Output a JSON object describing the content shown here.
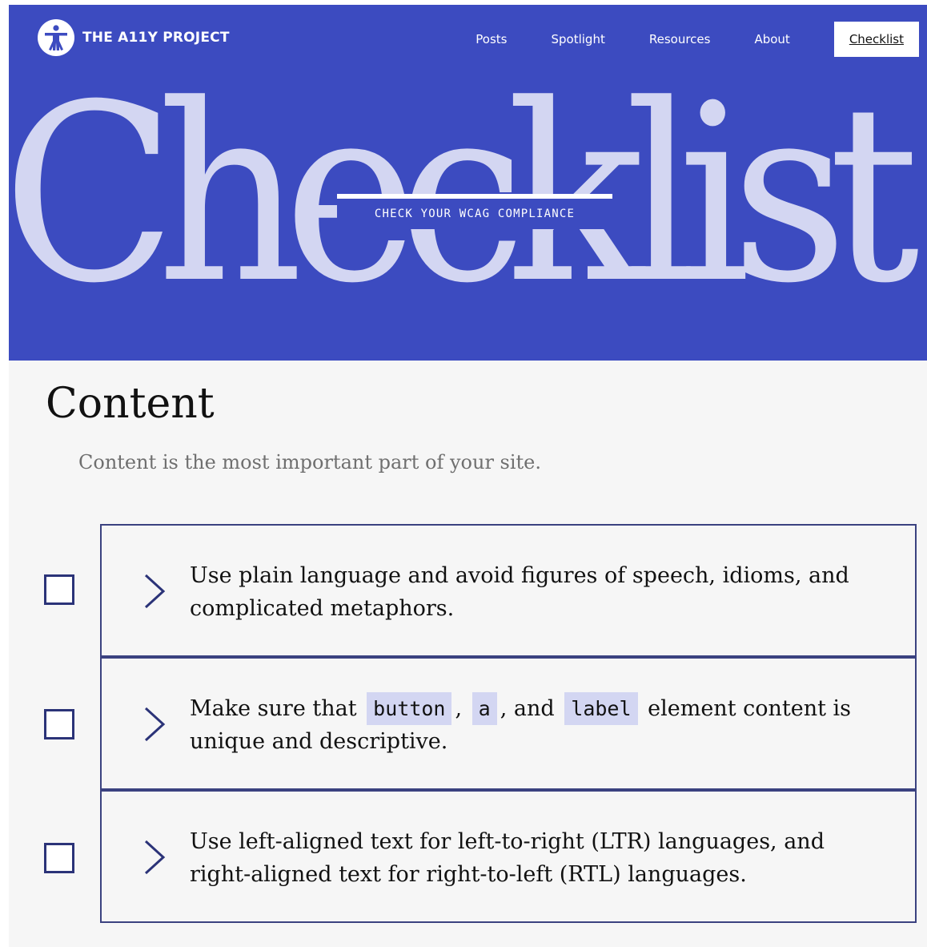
{
  "nav": {
    "logo_text": "THE A11Y PROJECT",
    "links": [
      "Posts",
      "Spotlight",
      "Resources",
      "About",
      "Checklist"
    ]
  },
  "hero": {
    "big_word": "Checklist",
    "tagline": "CHECK YOUR WCAG COMPLIANCE"
  },
  "section": {
    "title": "Content",
    "subtitle": "Content is the most important part of your site."
  },
  "items": [
    {
      "text": "Use plain language and avoid figures of speech, idioms, and complicated metaphors."
    },
    {
      "pre": "Make sure that",
      "code1": "button",
      "sep1": ",",
      "code2": "a",
      "sep2": ", and",
      "code3": "label",
      "post": "element content is unique and descriptive."
    },
    {
      "text": "Use left-aligned text for left-to-right (LTR) languages, and right-aligned text for right-to-left (RTL) languages."
    }
  ],
  "colors": {
    "hero_bg": "#3c4bc0",
    "hero_word": "#d3d6f2",
    "border": "#3b4280",
    "code_bg": "#d3d6f2"
  },
  "icons": [
    "accessibility-logo-icon",
    "checkbox-icon",
    "chevron-right-icon"
  ]
}
